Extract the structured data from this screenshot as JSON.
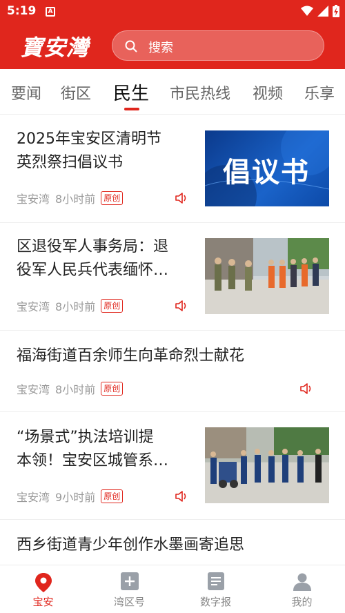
{
  "status_bar": {
    "time": "5:19",
    "notification_glyph": "A"
  },
  "header": {
    "logo_text": "寶安灣",
    "search_placeholder": "搜索"
  },
  "tabs": [
    {
      "label": "要闻"
    },
    {
      "label": "街区"
    },
    {
      "label": "民生",
      "active": true
    },
    {
      "label": "市民热线"
    },
    {
      "label": "视频"
    },
    {
      "label": "乐享"
    }
  ],
  "articles": [
    {
      "title_line1": "2025年宝安区清明节",
      "title_line2": "英烈祭扫倡议书",
      "source": "宝安湾",
      "time": "8小时前",
      "badge": "原创",
      "thumb_text": "倡议书"
    },
    {
      "title_line1": "区退役军人事务局：退",
      "title_line2": "役军人民兵代表缅怀…",
      "source": "宝安湾",
      "time": "8小时前",
      "badge": "原创"
    },
    {
      "title_line1": "福海街道百余师生向革命烈士献花",
      "source": "宝安湾",
      "time": "8小时前",
      "badge": "原创"
    },
    {
      "title_line1": "“场景式”执法培训提",
      "title_line2": "本领！宝安区城管系…",
      "source": "宝安湾",
      "time": "9小时前",
      "badge": "原创"
    },
    {
      "title_line1": "西乡街道青少年创作水墨画寄追思"
    }
  ],
  "bottom_nav": [
    {
      "label": "宝安",
      "icon": "location-pin-icon",
      "active": true
    },
    {
      "label": "湾区号",
      "icon": "plus-square-icon"
    },
    {
      "label": "数字报",
      "icon": "newspaper-icon"
    },
    {
      "label": "我的",
      "icon": "user-icon"
    }
  ],
  "colors": {
    "brand_red": "#e0261d",
    "text_dark": "#222222",
    "text_muted": "#999999"
  }
}
